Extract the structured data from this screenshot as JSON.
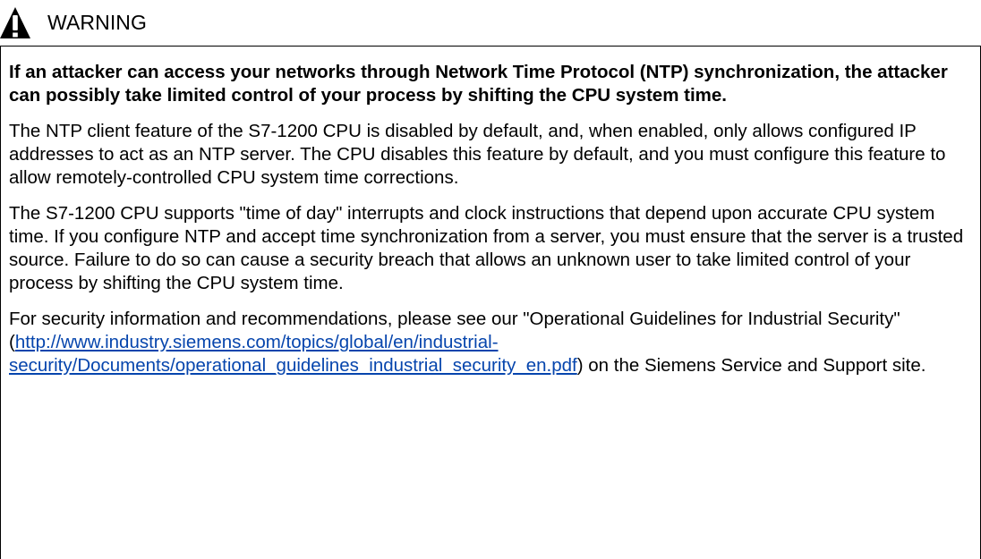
{
  "notice": {
    "signal_word": "WARNING",
    "icon": "warning-triangle-icon",
    "lead": "If an attacker can access your networks through Network Time Protocol (NTP) synchronization, the attacker can possibly take limited control of your process by shifting the CPU system time.",
    "paragraph_1": "The NTP client feature of the S7-1200 CPU is disabled by default, and, when enabled, only allows configured IP addresses to act as an NTP server. The CPU disables this feature by default, and you must configure this feature to allow remotely-controlled CPU system time corrections.",
    "paragraph_2": "The S7-1200 CPU supports \"time of day\" interrupts and clock instructions that depend upon accurate CPU system time. If you configure NTP and accept time synchronization from a server, you must ensure that the server is a trusted source. Failure to do so can cause a security breach that allows an unknown user to take limited control of your process by shifting the CPU system time.",
    "paragraph_3_before": "For security information and recommendations, please see our \"Operational Guidelines for Industrial Security\" (",
    "paragraph_3_link": "http://www.industry.siemens.com/topics/global/en/industrial-security/Documents/operational_guidelines_industrial_security_en.pdf",
    "paragraph_3_after": ") on the Siemens Service and Support site."
  },
  "colors": {
    "text": "#000000",
    "link": "#0645ad",
    "border": "#000000"
  }
}
